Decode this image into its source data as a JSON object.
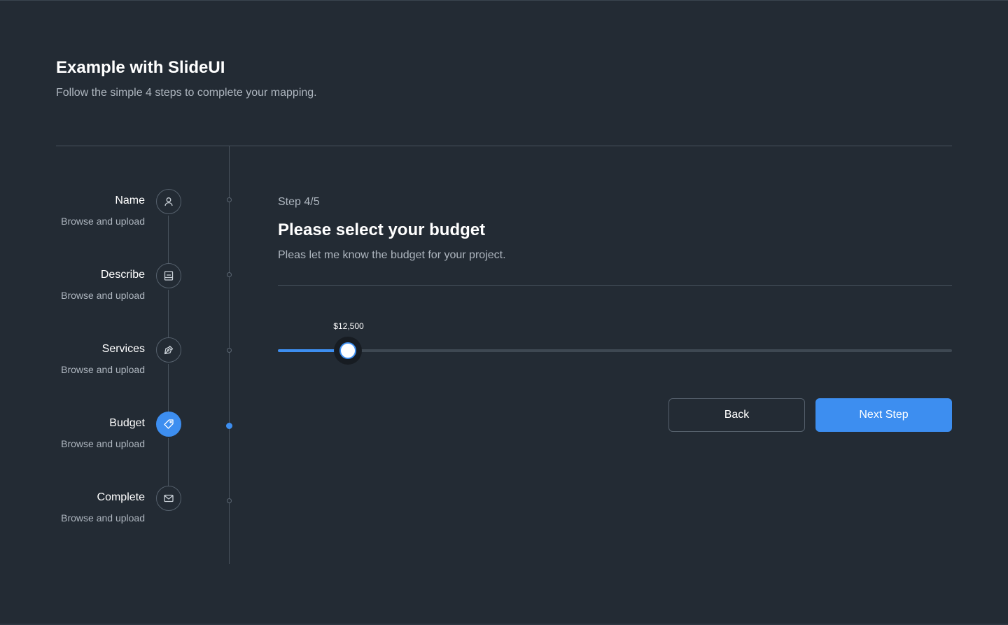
{
  "header": {
    "title": "Example with SlideUI",
    "subtitle": "Follow the simple 4 steps to complete your mapping."
  },
  "steps": [
    {
      "title": "Name",
      "description": "Browse and upload",
      "icon": "user-icon",
      "active": false
    },
    {
      "title": "Describe",
      "description": "Browse and upload",
      "icon": "document-icon",
      "active": false
    },
    {
      "title": "Services",
      "description": "Browse and upload",
      "icon": "pen-tool-icon",
      "active": false
    },
    {
      "title": "Budget",
      "description": "Browse and upload",
      "icon": "tag-icon",
      "active": true
    },
    {
      "title": "Complete",
      "description": "Browse and upload",
      "icon": "mail-icon",
      "active": false
    }
  ],
  "content": {
    "step_counter": "Step 4/5",
    "title": "Please select your budget",
    "description": "Pleas let me know the budget for your project."
  },
  "budget_slider": {
    "value_label": "$12,500",
    "fill_fraction": 0.104
  },
  "buttons": {
    "back_label": "Back",
    "next_label": "Next Step"
  },
  "colors": {
    "background": "#232b34",
    "accent": "#3d8ef0",
    "muted_text": "#aeb6bf",
    "divider": "#48525d"
  }
}
